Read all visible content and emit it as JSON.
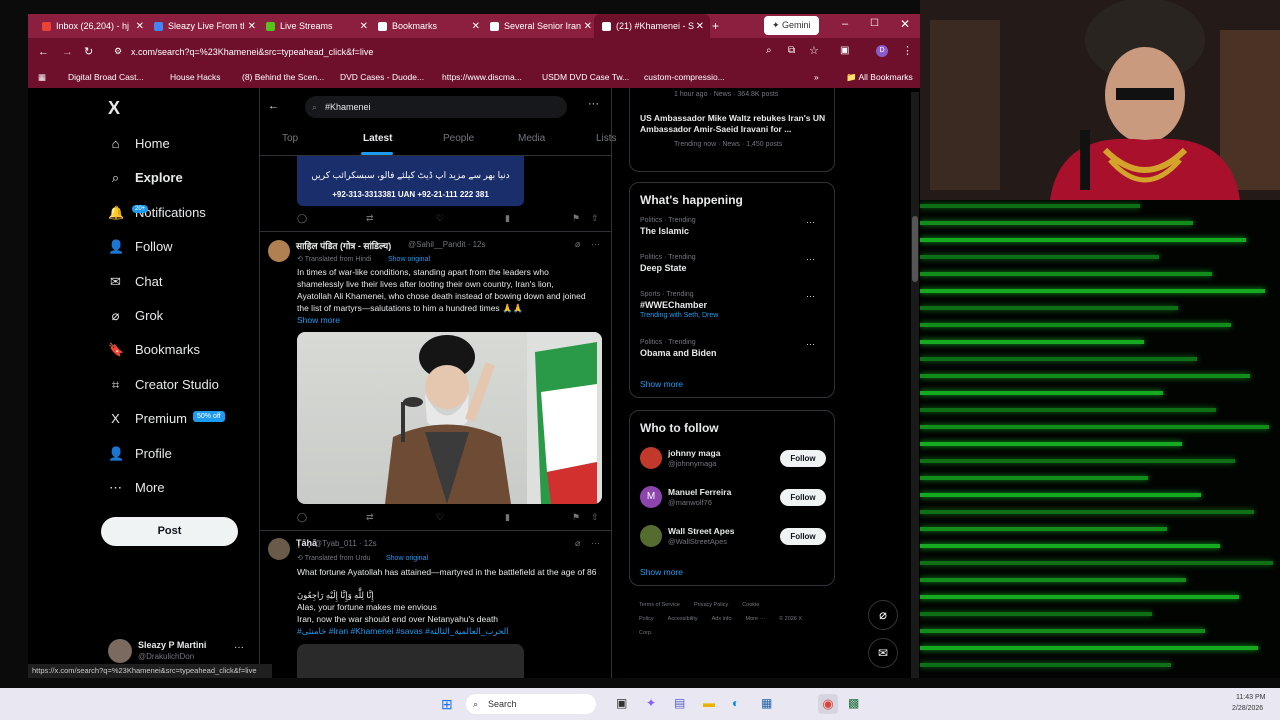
{
  "browser": {
    "tabs": [
      {
        "label": "Inbox (26,204) - hj",
        "color": "#ea4335"
      },
      {
        "label": "Sleazy Live From tl",
        "color": "#4285f4"
      },
      {
        "label": "Live Streams",
        "color": "#52c41a"
      },
      {
        "label": "Bookmarks",
        "color": "#ffffff"
      },
      {
        "label": "Several Senior Iran",
        "color": "#ffffff"
      },
      {
        "label": "(21) #Khamenei - S",
        "color": "#ffffff"
      }
    ],
    "gemini_label": "Gemini",
    "url": "x.com/search?q=%23Khamenei&src=typeahead_click&f=live",
    "bookmarks": [
      "Digital Broad Cast...",
      "House Hacks",
      "(8) Behind the Scen...",
      "DVD Cases - Duode...",
      "https://www.discma...",
      "USDM DVD Case Tw...",
      "custom-compressio..."
    ],
    "all_bookmarks": "All Bookmarks",
    "status_url": "https://x.com/search?q=%23Khamenei&src=typeahead_click&f=live"
  },
  "nav": {
    "logo": "X",
    "items": [
      {
        "label": "Home",
        "icon": "home-icon",
        "glyph": "⌂"
      },
      {
        "label": "Explore",
        "icon": "search-icon",
        "glyph": "⌕"
      },
      {
        "label": "Notifications",
        "icon": "bell-icon",
        "glyph": "🔔"
      },
      {
        "label": "Follow",
        "icon": "person-add-icon",
        "glyph": "👤"
      },
      {
        "label": "Chat",
        "icon": "mail-icon",
        "glyph": "✉"
      },
      {
        "label": "Grok",
        "icon": "grok-icon",
        "glyph": "⌀"
      },
      {
        "label": "Bookmarks",
        "icon": "bookmark-icon",
        "glyph": "🔖"
      },
      {
        "label": "Creator Studio",
        "icon": "creator-icon",
        "glyph": "⌗"
      },
      {
        "label": "Premium",
        "icon": "x-premium-icon",
        "glyph": "X"
      },
      {
        "label": "Profile",
        "icon": "profile-icon",
        "glyph": "👤"
      },
      {
        "label": "More",
        "icon": "more-icon",
        "glyph": "⋯"
      }
    ],
    "notif_badge": "20+",
    "premium_badge": "50% off",
    "post_label": "Post",
    "account_name": "Sleazy P Martini",
    "account_handle": "@DrakulichDon"
  },
  "search": {
    "query": "#Khamenei",
    "tabs": [
      "Top",
      "Latest",
      "People",
      "Media",
      "Lists"
    ],
    "active_tab": "Latest"
  },
  "tweets": [
    {
      "banner_text": "دنیا بھر سے مزید اپ ڈیٹ کیلئے فالو، سبسکرائب کریں",
      "banner_phone": "+92-313-3313381   UAN +92-21-111 222 381"
    },
    {
      "name": "साहिल पंडित (गोत्र - सांडिल्य)",
      "handle": "@Sahil__Pandit · 12s",
      "translated": "Translated from Hindi",
      "show_original": "Show original",
      "text": "In times of war-like conditions, standing apart from the leaders who shamelessly live their lives after looting their own country, Iran's lion, Ayatollah Ali Khamenei, who chose death instead of bowing down and joined the list of martyrs—salutations to him a hundred times 🙏🙏",
      "show_more": "Show more"
    },
    {
      "name": "Ṭāḥā",
      "handle": "@Tyab_011 · 12s",
      "translated": "Translated from Urdu",
      "show_original": "Show original",
      "line1": "What fortune Ayatollah has attained—martyred in the battlefield at the age of 86",
      "line2": "إِنَّا لِلَّٰهِ وَإِنَّا إِلَيْهِ رَاجِعُونَ",
      "line3": "Alas, your fortune makes me envious",
      "line4": "Iran, now the war should end over Netanyahu's death",
      "hashtags": "#خامنئی #Iran #Khamenei #savas #الحرب_العالمية_الثالثة"
    }
  ],
  "sidebar": {
    "top_meta": "1 hour ago · News · 364.8K posts",
    "top_headline": "US Ambassador Mike Waltz rebukes Iran's UN Ambassador Amir-Saeid Iravani for ...",
    "top_headline_meta": "Trending now · News · 1,450 posts",
    "happening_title": "What's happening",
    "trends": [
      {
        "category": "Politics · Trending",
        "name": "The Islamic",
        "extra": ""
      },
      {
        "category": "Politics · Trending",
        "name": "Deep State",
        "extra": ""
      },
      {
        "category": "Sports · Trending",
        "name": "#WWEChamber",
        "extra": "Trending with Seth, Drew"
      },
      {
        "category": "Politics · Trending",
        "name": "Obama and Biden",
        "extra": ""
      }
    ],
    "show_more": "Show more",
    "who_to_follow": "Who to follow",
    "follow_suggestions": [
      {
        "name": "johnny maga",
        "handle": "@johnnymaga",
        "color": "#c0392b",
        "initial": ""
      },
      {
        "name": "Manuel Ferreira",
        "handle": "@manwolf76",
        "color": "#8e44ad",
        "initial": "M"
      },
      {
        "name": "Wall Street Apes",
        "handle": "@WallStreetApes",
        "color": "#556b2f",
        "initial": ""
      }
    ],
    "follow_label": "Follow",
    "footer": [
      "Terms of Service",
      "Privacy Policy",
      "Cookie Policy",
      "Accessibility",
      "Ads info",
      "More ···",
      "© 2026 X Corp."
    ]
  },
  "taskbar": {
    "search_label": "Search",
    "time": "11:43 PM",
    "date": "2/28/2026"
  }
}
